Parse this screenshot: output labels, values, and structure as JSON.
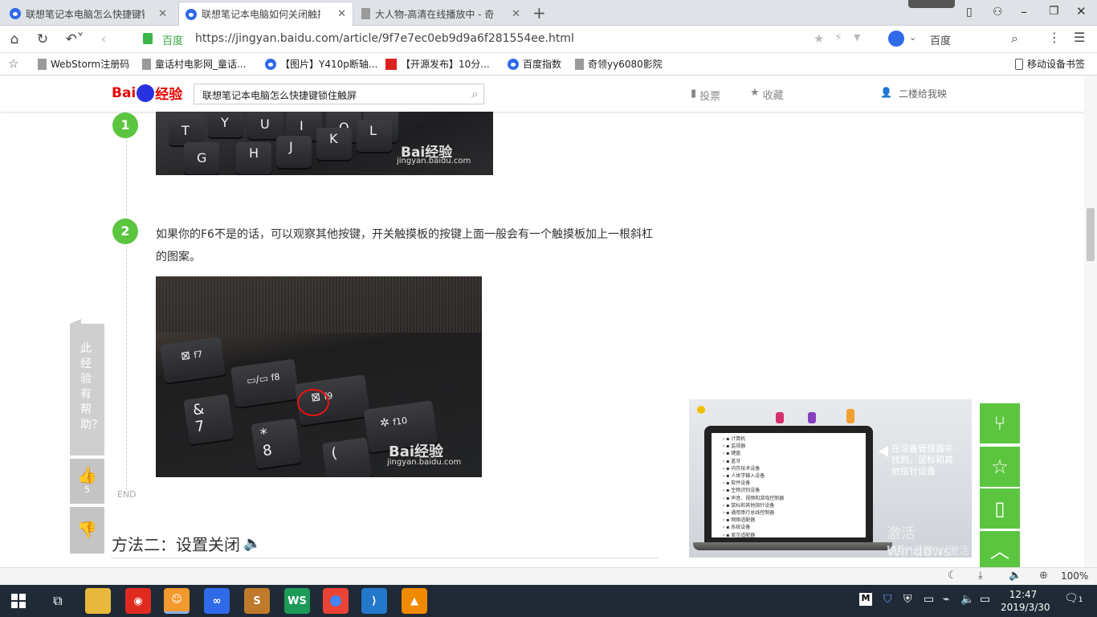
{
  "browser": {
    "tabs": [
      {
        "title": "联想笔记本电脑怎么快捷键锁",
        "active": false,
        "icon": "baidu-paw-icon"
      },
      {
        "title": "联想笔记本电脑如何关闭触摸",
        "active": true,
        "icon": "baidu-paw-icon"
      },
      {
        "title": "大人物-高清在线播放中 - 奇领",
        "active": false,
        "icon": "document-icon"
      }
    ],
    "secure_label": "百度",
    "url": "https://jingyan.baidu.com/article/9f7e7ec0eb9d9a6f281554ee.html",
    "search_engine": "百度",
    "bookmarks": [
      {
        "label": "WebStorm注册码",
        "icon": "document-icon"
      },
      {
        "label": "童话村电影网_童话...",
        "icon": "document-icon"
      },
      {
        "label": "【图片】Y410p断轴...",
        "icon": "baidu-paw-icon"
      },
      {
        "label": "【开源发布】10分...",
        "icon": "red-badge-icon"
      },
      {
        "label": "百度指数",
        "icon": "baidu-paw-icon"
      },
      {
        "label": "奇领yy6080影院",
        "icon": "document-icon"
      }
    ],
    "mobile_bookmarks": "移动设备书签"
  },
  "site": {
    "logo_text_a": "Bai",
    "logo_text_b": "经验",
    "search_value": "联想笔记本电脑怎么快捷键锁住触屏",
    "vote": "投票",
    "favorite": "收藏",
    "user": "二楼给我映"
  },
  "article": {
    "step1_num": "1",
    "step2_num": "2",
    "step2_text": "如果你的F6不是的话，可以观察其他按键，开关触摸板的按键上面一般会有一个触摸板加上一根斜杠的图案。",
    "watermark_brand": "Bai经验",
    "watermark_url": "jingyan.baidu.com",
    "end_label": "END",
    "method2_title": "方法二：设置关闭"
  },
  "help_widget": {
    "question": "此经验有帮助？",
    "like_count": "5"
  },
  "ad": {
    "caption": "在设备管理器中找到，鼠标和其他指针设备",
    "win_notice_1": "激活 Windows",
    "win_notice_2": "转到\"设置\"以激活 Windows。",
    "device_list": [
      "计算机",
      "监视器",
      "键盘",
      "蓝牙",
      "内存技术设备",
      "人体学输入设备",
      "软件设备",
      "生物识别设备",
      "声音、视频和游戏控制器",
      "鼠标和其他指针设备",
      "通用串行总线控制器",
      "网络适配器",
      "系统设备",
      "显示适配器"
    ]
  },
  "statusbar": {
    "zoom": "100%"
  },
  "taskbar": {
    "time": "12:47",
    "date": "2019/3/30",
    "notif_count": "1"
  },
  "colors": {
    "green": "#5cc53f",
    "baidu_blue": "#2932e1",
    "baidu_red": "#e10601"
  }
}
